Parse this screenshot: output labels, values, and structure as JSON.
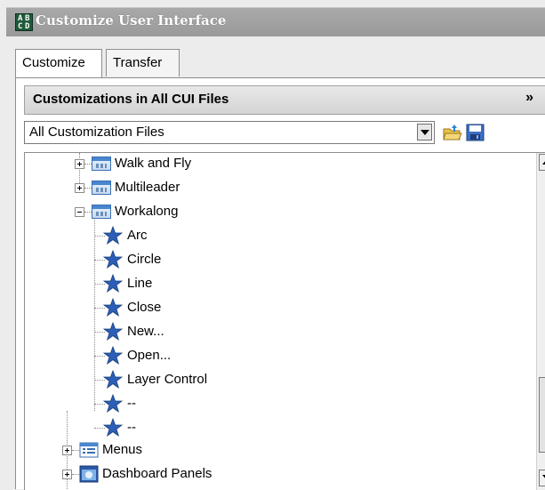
{
  "window": {
    "title": "Customize User Interface",
    "icon": "app-icon"
  },
  "tabs": [
    {
      "label": "Customize",
      "active": true
    },
    {
      "label": "Transfer",
      "active": false
    }
  ],
  "panel": {
    "title": "Customizations in All CUI Files",
    "collapse_icon": "double-chevron-up-icon",
    "dropdown": {
      "selected": "All Customization Files"
    },
    "toolbar_icons": [
      "open-file-icon",
      "save-icon"
    ]
  },
  "tree": {
    "items": [
      {
        "label": "Walk and Fly",
        "icon": "toolbar-icon",
        "expander": "plus"
      },
      {
        "label": "Multileader",
        "icon": "toolbar-icon",
        "expander": "plus"
      },
      {
        "label": "Workalong",
        "icon": "toolbar-icon",
        "expander": "minus"
      },
      {
        "label": "Arc",
        "icon": "star-icon"
      },
      {
        "label": "Circle",
        "icon": "star-icon"
      },
      {
        "label": "Line",
        "icon": "star-icon"
      },
      {
        "label": "Close",
        "icon": "star-icon"
      },
      {
        "label": "New...",
        "icon": "star-icon"
      },
      {
        "label": "Open...",
        "icon": "star-icon"
      },
      {
        "label": "Layer Control",
        "icon": "star-icon"
      },
      {
        "label": "--",
        "icon": "star-icon"
      },
      {
        "label": "--",
        "icon": "star-icon"
      },
      {
        "label": "Menus",
        "icon": "menu-icon",
        "expander": "plus"
      },
      {
        "label": "Dashboard Panels",
        "icon": "dashboard-icon",
        "expander": "plus"
      }
    ]
  },
  "colors": {
    "star": "#2b5fb6",
    "titlebar": "#9e9e9e",
    "accent": "#4a86cf"
  }
}
